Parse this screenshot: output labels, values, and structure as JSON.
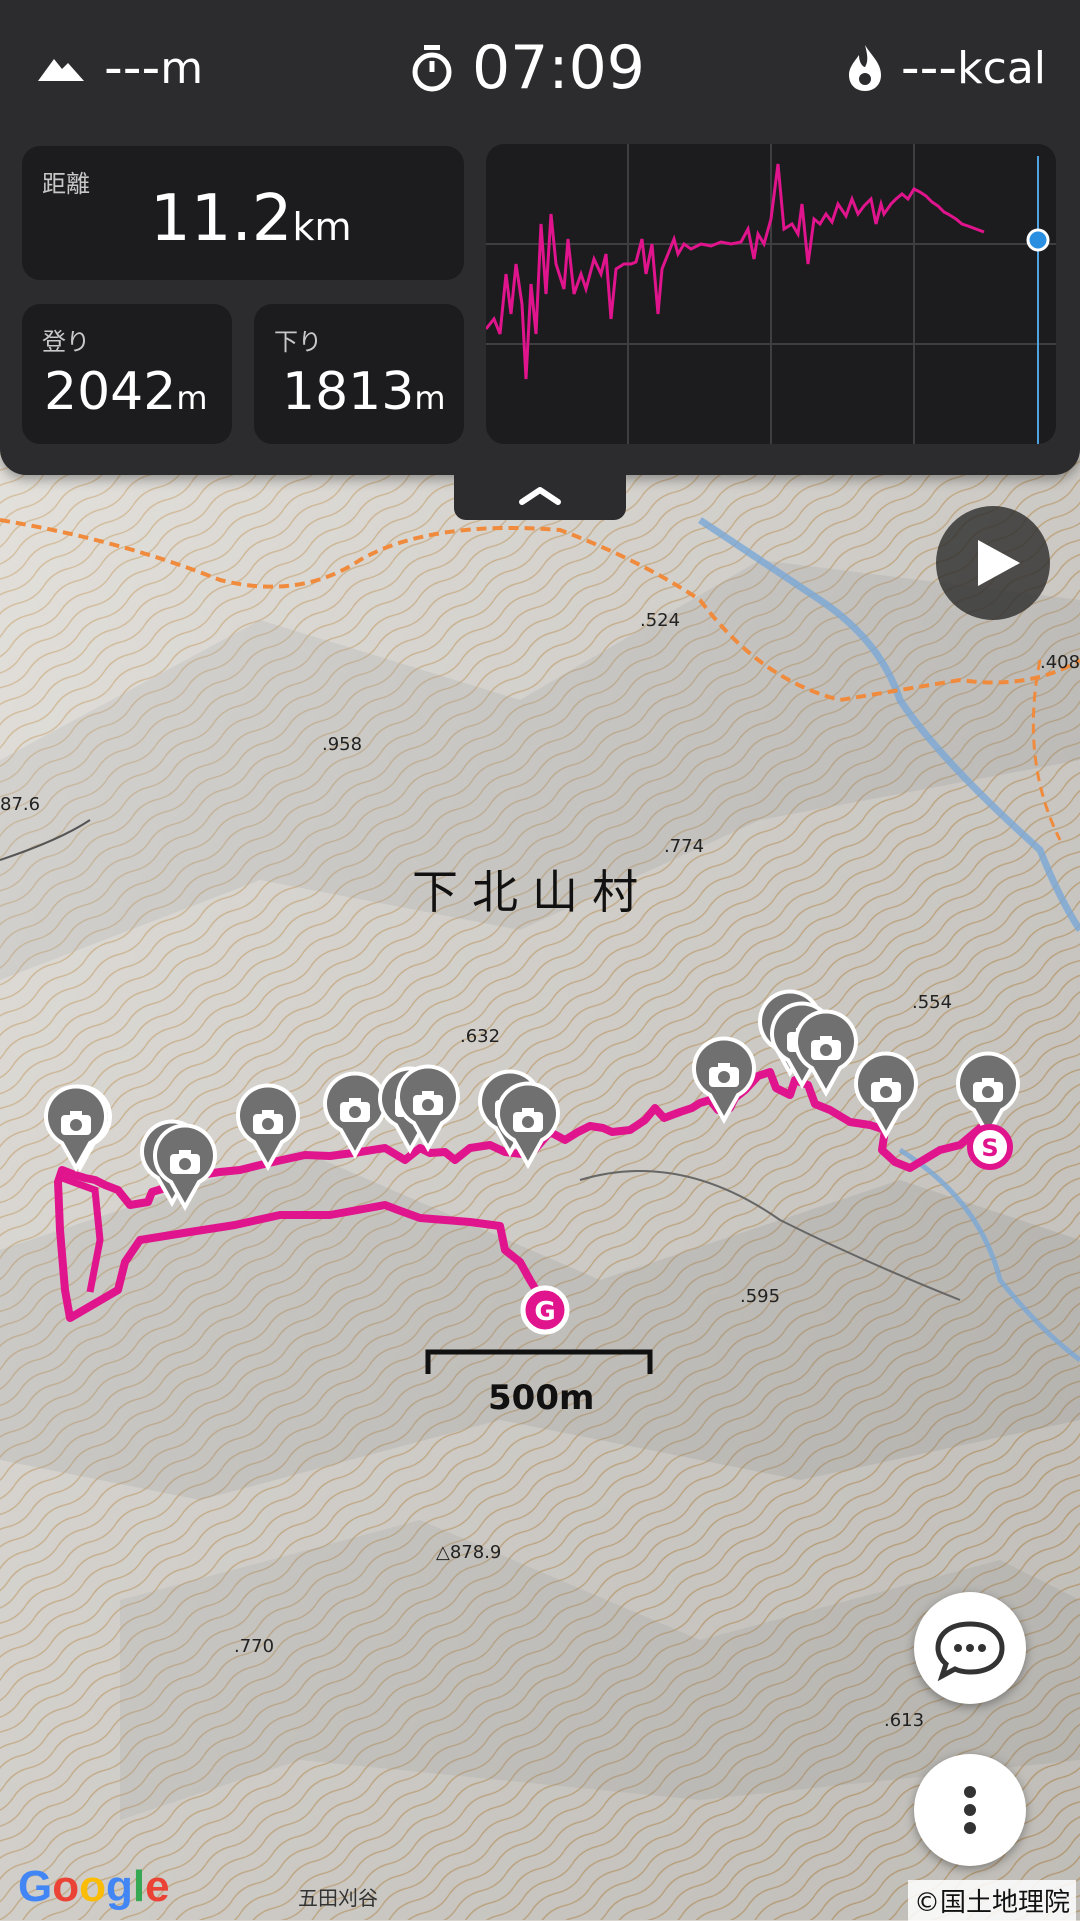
{
  "stats": {
    "altitude": "---",
    "altitude_unit": "m",
    "elapsed_time": "07:09",
    "calories": "---",
    "calories_unit": "kcal",
    "distance_label": "距離",
    "distance_value": "11.2",
    "distance_unit": "km",
    "ascent_label": "登り",
    "ascent_value": "2042",
    "ascent_unit": "m",
    "descent_label": "下り",
    "descent_value": "1813",
    "descent_unit": "m"
  },
  "map": {
    "place_name": "下北山村",
    "scale_label": "500m",
    "spot_heights": [
      ".524",
      ".408",
      ".958",
      "87.6",
      ".774",
      ".632",
      ".554",
      ".595",
      "△878.9",
      ".770",
      ".613"
    ],
    "valley_name": "五田刈谷",
    "start_marker": "S",
    "goal_marker": "G",
    "attribution_google": "Google",
    "attribution_gsi": "©国土地理院",
    "track_color": "#e0148c"
  },
  "icons": {
    "altitude": "mountain-icon",
    "time": "stopwatch-icon",
    "calories": "flame-icon",
    "collapse": "chevron-up-icon",
    "play": "play-icon",
    "chat": "speech-bubble-icon",
    "more": "more-vertical-icon",
    "photo": "camera-pin-icon"
  }
}
